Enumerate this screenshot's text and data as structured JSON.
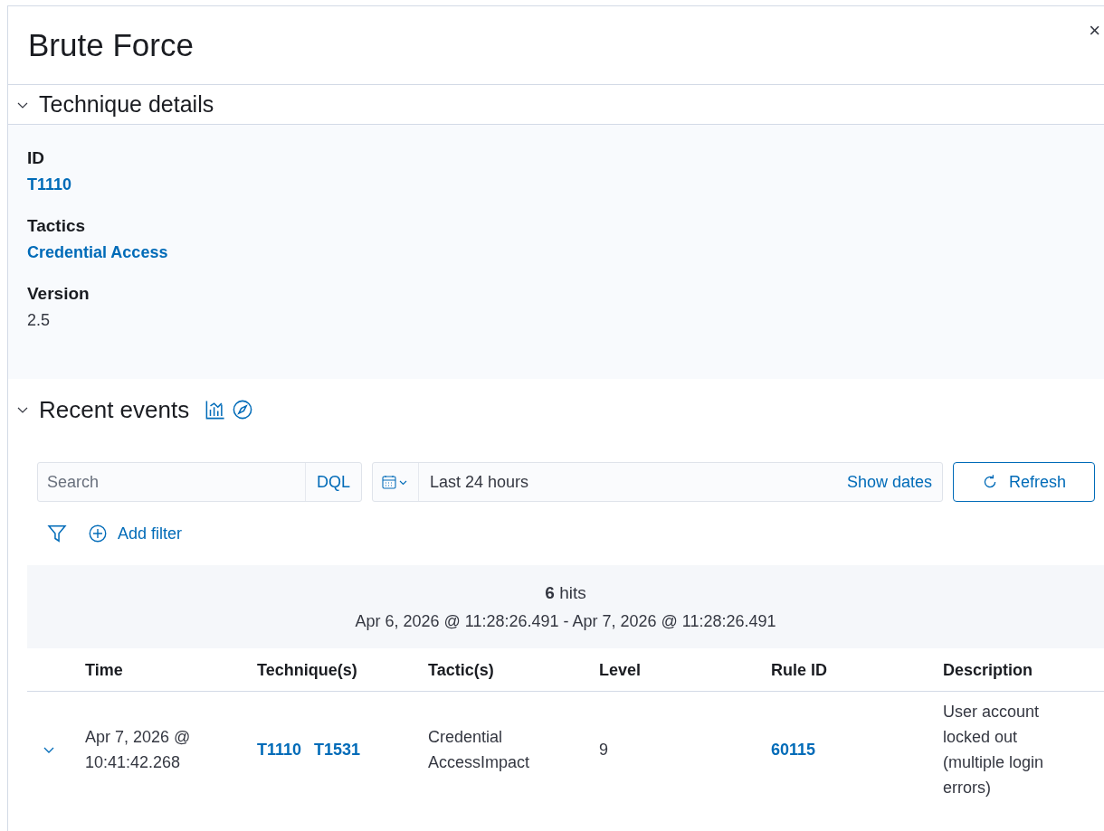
{
  "flyout": {
    "title": "Brute Force",
    "close": "×"
  },
  "technique_details": {
    "title": "Technique details",
    "expanded": true,
    "fields": [
      {
        "label": "ID",
        "value": "T1110",
        "kind": "link"
      },
      {
        "label": "Tactics",
        "value": "Credential Access",
        "kind": "link"
      },
      {
        "label": "Version",
        "value": "2.5",
        "kind": "text"
      }
    ]
  },
  "recent_events": {
    "title": "Recent events",
    "expanded": true,
    "search": {
      "placeholder": "Search",
      "language": "DQL"
    },
    "date_picker": {
      "range": "Last 24 hours",
      "show_dates": "Show dates"
    },
    "refresh_button": "Refresh",
    "add_filter": "Add filter",
    "hits": {
      "count": "6",
      "label": "hits",
      "range": "Apr 6, 2026 @ 11:28:26.491 - Apr 7, 2026 @ 11:28:26.491"
    },
    "table": {
      "columns": [
        "Time",
        "Technique(s)",
        "Tactic(s)",
        "Level",
        "Rule ID",
        "Description"
      ],
      "rows": [
        {
          "expanded": false,
          "time": "Apr 7, 2026 @ 10:41:42.268",
          "techniques": [
            "T1110",
            "T1531"
          ],
          "tactics": "Credential AccessImpact",
          "level": "9",
          "rule_id": "60115",
          "description": "User account locked out (multiple login errors)"
        }
      ]
    }
  }
}
